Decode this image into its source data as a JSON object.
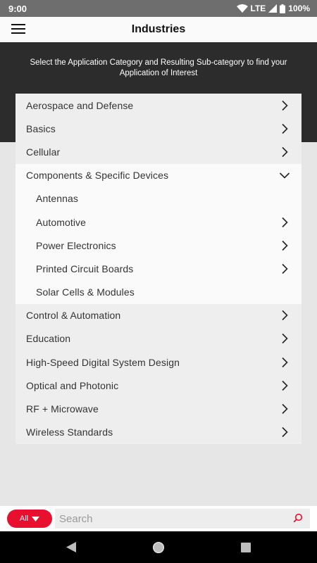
{
  "status": {
    "time": "9:00",
    "network": "LTE",
    "battery": "100%"
  },
  "header": {
    "title": "Industries"
  },
  "hero": {
    "text": "Select the Application Category and Resulting Sub-category to find your Application of Interest"
  },
  "categories": [
    {
      "label": "Aerospace and Defense"
    },
    {
      "label": "Basics"
    },
    {
      "label": "Cellular"
    },
    {
      "label": "Components & Specific Devices",
      "expanded": true
    },
    {
      "label": "Antennas",
      "sub": true
    },
    {
      "label": "Automotive",
      "sub": true
    },
    {
      "label": "Power Electronics",
      "sub": true
    },
    {
      "label": "Printed Circuit Boards",
      "sub": true
    },
    {
      "label": "Solar Cells & Modules",
      "sub": true
    },
    {
      "label": "Control & Automation"
    },
    {
      "label": "Education"
    },
    {
      "label": "High-Speed Digital System Design"
    },
    {
      "label": "Optical and Photonic"
    },
    {
      "label": "RF + Microwave"
    },
    {
      "label": "Wireless Standards"
    }
  ],
  "search": {
    "filter_label": "All",
    "placeholder": "Search"
  },
  "colors": {
    "accent": "#e8102e",
    "hero_bg": "#2c2c2c"
  }
}
